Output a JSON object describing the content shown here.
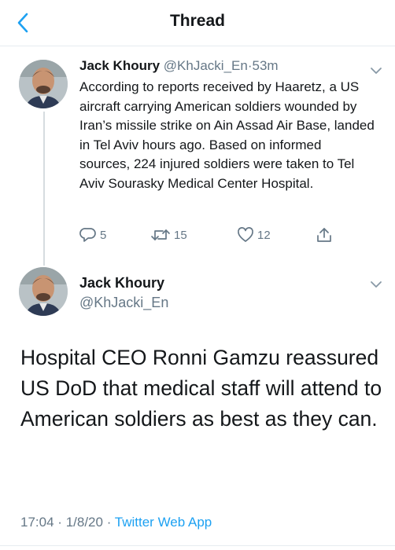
{
  "nav": {
    "back_icon": "chevron-left-icon",
    "title": "Thread",
    "accent_color": "#1da1f2"
  },
  "tweet1": {
    "avatar_icon": "avatar",
    "name": "Jack Khoury",
    "handle": "@KhJacki_En",
    "separator": "·",
    "time": "53m",
    "text": "According to reports received by Haaretz, a US aircraft carrying American soldiers wounded by Iran’s missile strike on Ain Assad Air Base, landed in Tel Aviv hours ago. Based on informed sources, 224 injured soldiers were taken to Tel Aviv Sourasky Medical Center Hospital.",
    "actions": {
      "reply_count": "5",
      "retweet_count": "15",
      "like_count": "12"
    }
  },
  "tweet2": {
    "avatar_icon": "avatar",
    "name": "Jack Khoury",
    "handle": "@KhJacki_En",
    "text": "Hospital CEO Ronni Gamzu reassured US DoD that medical staff will attend to American soldiers as best as they can.",
    "time": "17:04",
    "sep1": "·",
    "date": "1/8/20",
    "sep2": "·",
    "source": "Twitter Web App"
  }
}
